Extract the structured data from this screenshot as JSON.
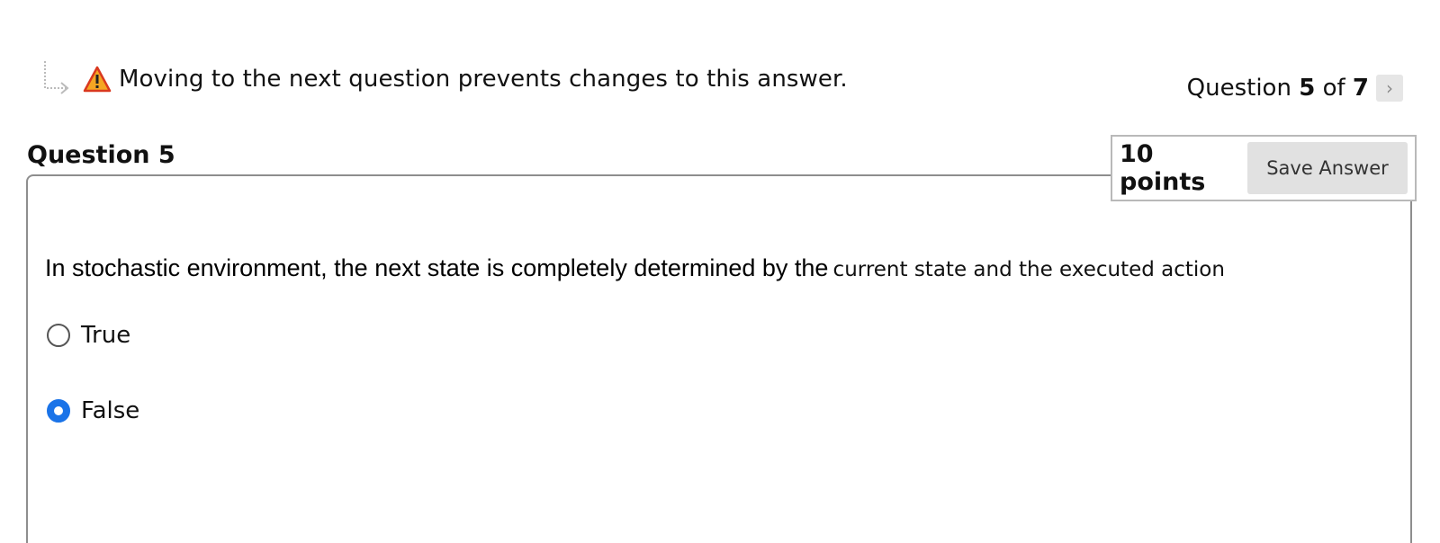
{
  "warning": {
    "text": "Moving to the next question prevents changes to this answer."
  },
  "counter": {
    "prefix": "Question ",
    "current": "5",
    "middle": " of ",
    "total": "7",
    "next_glyph": "›"
  },
  "question": {
    "title": "Question 5",
    "points": "10 points",
    "save_label": "Save Answer",
    "text_main": "In stochastic environment, the next state is completely determined by the",
    "text_tail": "current state and the executed action",
    "options": [
      {
        "label": "True",
        "selected": false
      },
      {
        "label": "False",
        "selected": true
      }
    ]
  },
  "colors": {
    "accent": "#1a73e8",
    "warning_icon": "#f5a623"
  },
  "icons": {
    "arrow": "return-arrow-icon",
    "warning": "warning-triangle-icon",
    "next": "chevron-right-icon"
  }
}
